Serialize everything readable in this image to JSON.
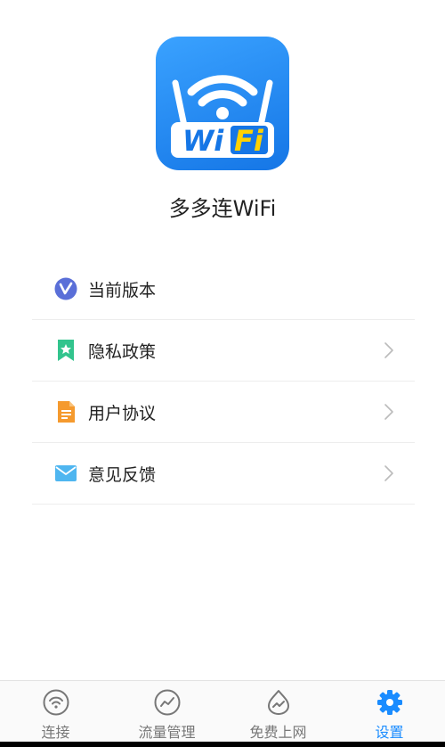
{
  "app": {
    "name": "多多连WiFi",
    "logo_text_wi": "Wi",
    "logo_text_fi": "Fi"
  },
  "menu": {
    "items": [
      {
        "label": "当前版本",
        "icon": "version-v-icon",
        "has_chevron": false
      },
      {
        "label": "隐私政策",
        "icon": "bookmark-star-icon",
        "has_chevron": true
      },
      {
        "label": "用户协议",
        "icon": "document-icon",
        "has_chevron": true
      },
      {
        "label": "意见反馈",
        "icon": "mail-icon",
        "has_chevron": true
      }
    ]
  },
  "bottom_nav": {
    "items": [
      {
        "label": "连接",
        "icon": "wifi-icon",
        "active": false
      },
      {
        "label": "流量管理",
        "icon": "chart-icon",
        "active": false
      },
      {
        "label": "免费上网",
        "icon": "flame-icon",
        "active": false
      },
      {
        "label": "设置",
        "icon": "gear-icon",
        "active": true
      }
    ]
  },
  "colors": {
    "brand": "#1a8cff",
    "logo_yellow": "#ffd200",
    "text_primary": "#222222",
    "nav_inactive": "#777777"
  }
}
